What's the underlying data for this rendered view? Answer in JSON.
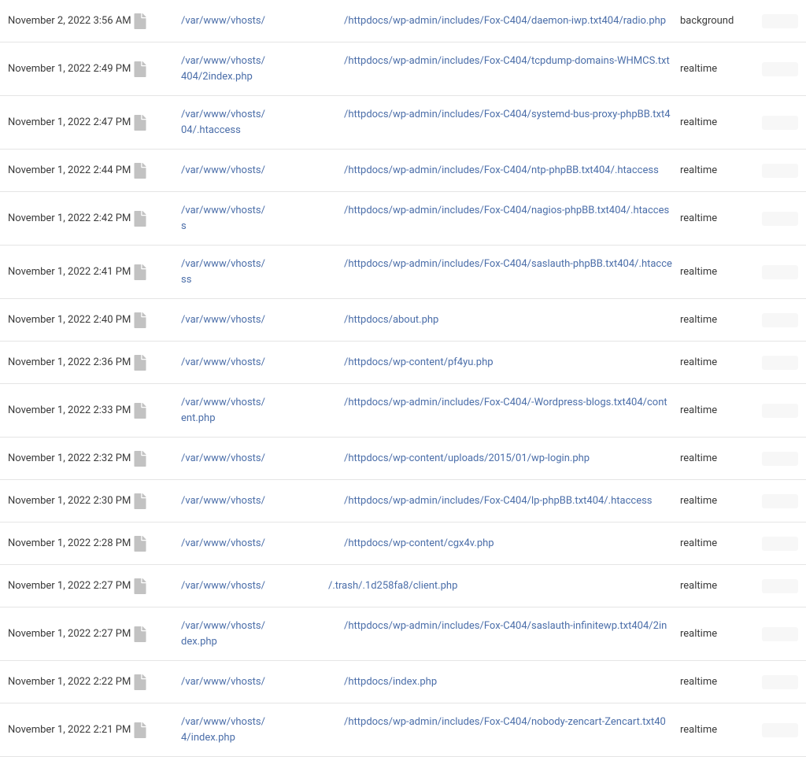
{
  "path_prefix": "/var/www/vhosts/",
  "rows": [
    {
      "date": "November 2, 2022 3:56 AM",
      "path_suffix": "/httpdocs/wp-admin/includes/Fox-C404/daemon-iwp.txt404/radio.php",
      "mode": "background",
      "trash_style": false
    },
    {
      "date": "November 1, 2022 2:49 PM",
      "path_suffix": "/httpdocs/wp-admin/includes/Fox-C404/tcpdump-domains-WHMCS.txt404/2index.php",
      "mode": "realtime",
      "trash_style": false
    },
    {
      "date": "November 1, 2022 2:47 PM",
      "path_suffix": "/httpdocs/wp-admin/includes/Fox-C404/systemd-bus-proxy-phpBB.txt404/.htaccess",
      "mode": "realtime",
      "trash_style": false
    },
    {
      "date": "November 1, 2022 2:44 PM",
      "path_suffix": "/httpdocs/wp-admin/includes/Fox-C404/ntp-phpBB.txt404/.htaccess",
      "mode": "realtime",
      "trash_style": false
    },
    {
      "date": "November 1, 2022 2:42 PM",
      "path_suffix": "/httpdocs/wp-admin/includes/Fox-C404/nagios-phpBB.txt404/.htaccess",
      "mode": "realtime",
      "trash_style": false
    },
    {
      "date": "November 1, 2022 2:41 PM",
      "path_suffix": "/httpdocs/wp-admin/includes/Fox-C404/saslauth-phpBB.txt404/.htaccess",
      "mode": "realtime",
      "trash_style": false
    },
    {
      "date": "November 1, 2022 2:40 PM",
      "path_suffix": "/httpdocs/about.php",
      "mode": "realtime",
      "trash_style": false
    },
    {
      "date": "November 1, 2022 2:36 PM",
      "path_suffix": "/httpdocs/wp-content/pf4yu.php",
      "mode": "realtime",
      "trash_style": false
    },
    {
      "date": "November 1, 2022 2:33 PM",
      "path_suffix": "/httpdocs/wp-admin/includes/Fox-C404/-Wordpress-blogs.txt404/content.php",
      "mode": "realtime",
      "trash_style": false
    },
    {
      "date": "November 1, 2022 2:32 PM",
      "path_suffix": "/httpdocs/wp-content/uploads/2015/01/wp-login.php",
      "mode": "realtime",
      "trash_style": false
    },
    {
      "date": "November 1, 2022 2:30 PM",
      "path_suffix": "/httpdocs/wp-admin/includes/Fox-C404/lp-phpBB.txt404/.htaccess",
      "mode": "realtime",
      "trash_style": false
    },
    {
      "date": "November 1, 2022 2:28 PM",
      "path_suffix": "/httpdocs/wp-content/cgx4v.php",
      "mode": "realtime",
      "trash_style": false
    },
    {
      "date": "November 1, 2022 2:27 PM",
      "path_suffix": "/.trash/.1d258fa8/client.php",
      "mode": "realtime",
      "trash_style": true
    },
    {
      "date": "November 1, 2022 2:27 PM",
      "path_suffix": "/httpdocs/wp-admin/includes/Fox-C404/saslauth-infinitewp.txt404/2index.php",
      "mode": "realtime",
      "trash_style": false
    },
    {
      "date": "November 1, 2022 2:22 PM",
      "path_suffix": "/httpdocs/index.php",
      "mode": "realtime",
      "trash_style": false
    },
    {
      "date": "November 1, 2022 2:21 PM",
      "path_suffix": "/httpdocs/wp-admin/includes/Fox-C404/nobody-zencart-Zencart.txt404/index.php",
      "mode": "realtime",
      "trash_style": false
    }
  ]
}
